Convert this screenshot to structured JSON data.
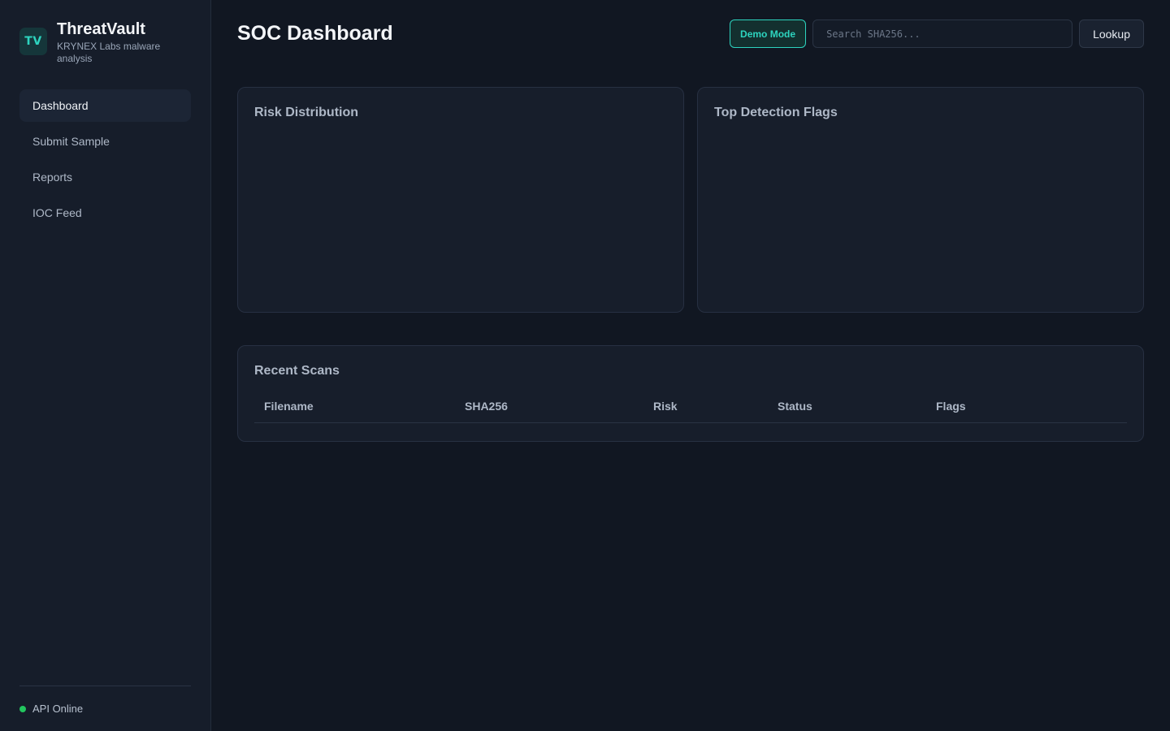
{
  "brand": {
    "logo": "TV",
    "name": "ThreatVault",
    "subtitle": "KRYNEX Labs malware analysis"
  },
  "nav": {
    "items": [
      {
        "label": "Dashboard",
        "active": true
      },
      {
        "label": "Submit Sample",
        "active": false
      },
      {
        "label": "Reports",
        "active": false
      },
      {
        "label": "IOC Feed",
        "active": false
      }
    ]
  },
  "status": {
    "label": "API Online",
    "color": "#22c55e"
  },
  "header": {
    "title": "SOC Dashboard",
    "demo_label": "Demo Mode",
    "search_placeholder": "Search SHA256...",
    "search_value": "",
    "lookup_label": "Lookup"
  },
  "cards": {
    "risk_title": "Risk Distribution",
    "flags_title": "Top Detection Flags"
  },
  "recent_scans": {
    "title": "Recent Scans",
    "columns": [
      "Filename",
      "SHA256",
      "Risk",
      "Status",
      "Flags"
    ],
    "rows": []
  },
  "colors": {
    "accent": "#2dd4bf",
    "background": "#111722",
    "sidebar": "#161d2a",
    "card": "#171e2b"
  }
}
